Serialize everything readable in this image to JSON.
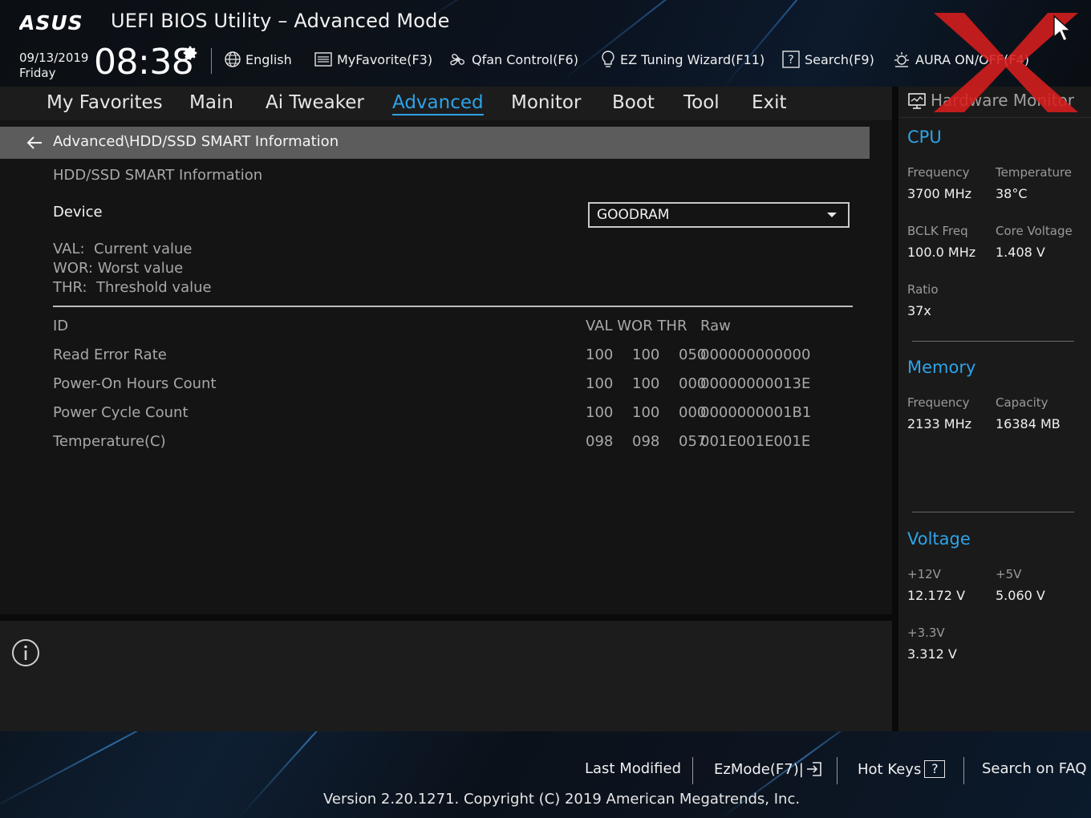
{
  "header": {
    "brand": "ASUS",
    "title": "UEFI BIOS Utility – Advanced Mode",
    "date": "09/13/2019",
    "day": "Friday",
    "time": "08:38",
    "toolbar": [
      {
        "label": "English",
        "icon": "globe-icon"
      },
      {
        "label": "MyFavorite(F3)",
        "icon": "favorite-list-icon"
      },
      {
        "label": "Qfan Control(F6)",
        "icon": "fan-icon"
      },
      {
        "label": "EZ Tuning Wizard(F11)",
        "icon": "lightbulb-icon"
      },
      {
        "label": "Search(F9)",
        "icon": "search-help-icon"
      },
      {
        "label": "AURA ON/OFF(F4)",
        "icon": "aura-icon"
      }
    ]
  },
  "menu": {
    "tabs": [
      "My Favorites",
      "Main",
      "Ai Tweaker",
      "Advanced",
      "Monitor",
      "Boot",
      "Tool",
      "Exit"
    ],
    "active": "Advanced"
  },
  "main": {
    "breadcrumb": "Advanced\\HDD/SSD SMART Information",
    "section_title": "HDD/SSD SMART Information",
    "device_label": "Device",
    "device_value": "GOODRAM",
    "legend": [
      "VAL:  Current value",
      "WOR: Worst value",
      "THR:  Threshold value"
    ],
    "table": {
      "headers": {
        "id": "ID",
        "vwt": "VAL WOR THR",
        "raw": "Raw"
      },
      "rows": [
        {
          "id": "Read Error Rate",
          "val": "100",
          "wor": "100",
          "thr": "050",
          "raw": "000000000000"
        },
        {
          "id": "Power-On Hours Count",
          "val": "100",
          "wor": "100",
          "thr": "000",
          "raw": "00000000013E"
        },
        {
          "id": "Power Cycle Count",
          "val": "100",
          "wor": "100",
          "thr": "000",
          "raw": "0000000001B1"
        },
        {
          "id": "Temperature(C)",
          "val": "098",
          "wor": "098",
          "thr": "057",
          "raw": "001E001E001E"
        }
      ]
    }
  },
  "hwmon": {
    "title": "Hardware Monitor",
    "cpu": {
      "heading": "CPU",
      "frequency_label": "Frequency",
      "frequency": "3700 MHz",
      "temperature_label": "Temperature",
      "temperature": "38°C",
      "bclk_label": "BCLK Freq",
      "bclk": "100.0 MHz",
      "core_voltage_label": "Core Voltage",
      "core_voltage": "1.408 V",
      "ratio_label": "Ratio",
      "ratio": "37x"
    },
    "memory": {
      "heading": "Memory",
      "frequency_label": "Frequency",
      "frequency": "2133 MHz",
      "capacity_label": "Capacity",
      "capacity": "16384 MB"
    },
    "voltage": {
      "heading": "Voltage",
      "v12_label": "+12V",
      "v12": "12.172 V",
      "v5_label": "+5V",
      "v5": "5.060 V",
      "v33_label": "+3.3V",
      "v33": "3.312 V"
    }
  },
  "footer": {
    "last_modified": "Last Modified",
    "ezmode": "EzMode(F7)|",
    "hot_keys": "Hot Keys",
    "hot_keys_key": "?",
    "search_faq": "Search on FAQ",
    "version": "Version 2.20.1271. Copyright (C) 2019 American Megatrends, Inc."
  },
  "colors": {
    "accent": "#2ea3e8",
    "breadcrumb_bg": "#5c5c5c",
    "watermark": "#d81e1e"
  }
}
